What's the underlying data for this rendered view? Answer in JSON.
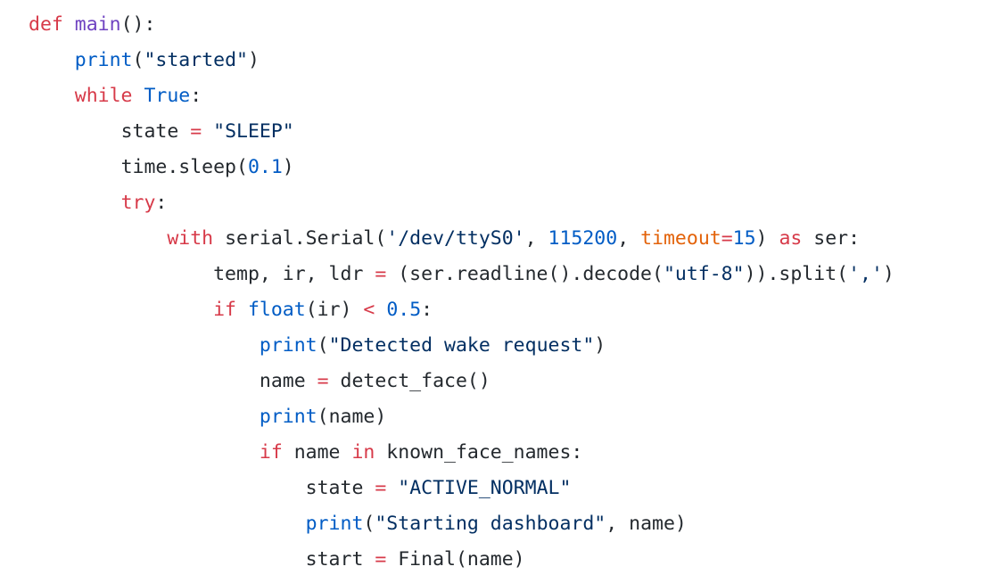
{
  "colors": {
    "keyword": "#d73a49",
    "function_def": "#6f42c1",
    "builtin": "#005cc5",
    "string": "#032f62",
    "number": "#005cc5",
    "operator": "#d73a49",
    "text": "#24292e",
    "param": "#e36209"
  },
  "code": {
    "language": "python",
    "lines": [
      {
        "indent": 0,
        "tokens": [
          {
            "t": "kw",
            "v": "def"
          },
          {
            "t": "var",
            "v": " "
          },
          {
            "t": "fn",
            "v": "main"
          },
          {
            "t": "var",
            "v": "():"
          }
        ]
      },
      {
        "indent": 1,
        "tokens": [
          {
            "t": "bi",
            "v": "print"
          },
          {
            "t": "var",
            "v": "("
          },
          {
            "t": "str",
            "v": "\"started\""
          },
          {
            "t": "var",
            "v": ")"
          }
        ]
      },
      {
        "indent": 1,
        "tokens": [
          {
            "t": "kw",
            "v": "while"
          },
          {
            "t": "var",
            "v": " "
          },
          {
            "t": "bi",
            "v": "True"
          },
          {
            "t": "var",
            "v": ":"
          }
        ]
      },
      {
        "indent": 2,
        "tokens": [
          {
            "t": "var",
            "v": "state "
          },
          {
            "t": "op",
            "v": "="
          },
          {
            "t": "var",
            "v": " "
          },
          {
            "t": "str",
            "v": "\"SLEEP\""
          }
        ]
      },
      {
        "indent": 2,
        "tokens": [
          {
            "t": "var",
            "v": "time.sleep("
          },
          {
            "t": "num",
            "v": "0.1"
          },
          {
            "t": "var",
            "v": ")"
          }
        ]
      },
      {
        "indent": 2,
        "tokens": [
          {
            "t": "kw",
            "v": "try"
          },
          {
            "t": "var",
            "v": ":"
          }
        ]
      },
      {
        "indent": 3,
        "tokens": [
          {
            "t": "kw",
            "v": "with"
          },
          {
            "t": "var",
            "v": " serial.Serial("
          },
          {
            "t": "str",
            "v": "'/dev/ttyS0'"
          },
          {
            "t": "var",
            "v": ", "
          },
          {
            "t": "num",
            "v": "115200"
          },
          {
            "t": "var",
            "v": ", "
          },
          {
            "t": "param",
            "v": "timeout"
          },
          {
            "t": "op",
            "v": "="
          },
          {
            "t": "num",
            "v": "15"
          },
          {
            "t": "var",
            "v": ") "
          },
          {
            "t": "kw",
            "v": "as"
          },
          {
            "t": "var",
            "v": " ser:"
          }
        ]
      },
      {
        "indent": 4,
        "tokens": [
          {
            "t": "var",
            "v": "temp, ir, ldr "
          },
          {
            "t": "op",
            "v": "="
          },
          {
            "t": "var",
            "v": " (ser.readline().decode("
          },
          {
            "t": "str",
            "v": "\"utf-8\""
          },
          {
            "t": "var",
            "v": ")).split("
          },
          {
            "t": "str",
            "v": "','"
          },
          {
            "t": "var",
            "v": ")"
          }
        ]
      },
      {
        "indent": 4,
        "tokens": [
          {
            "t": "kw",
            "v": "if"
          },
          {
            "t": "var",
            "v": " "
          },
          {
            "t": "bi",
            "v": "float"
          },
          {
            "t": "var",
            "v": "(ir) "
          },
          {
            "t": "op",
            "v": "<"
          },
          {
            "t": "var",
            "v": " "
          },
          {
            "t": "num",
            "v": "0.5"
          },
          {
            "t": "var",
            "v": ":"
          }
        ]
      },
      {
        "indent": 5,
        "tokens": [
          {
            "t": "bi",
            "v": "print"
          },
          {
            "t": "var",
            "v": "("
          },
          {
            "t": "str",
            "v": "\"Detected wake request\""
          },
          {
            "t": "var",
            "v": ")"
          }
        ]
      },
      {
        "indent": 5,
        "tokens": [
          {
            "t": "var",
            "v": "name "
          },
          {
            "t": "op",
            "v": "="
          },
          {
            "t": "var",
            "v": " detect_face()"
          }
        ]
      },
      {
        "indent": 5,
        "tokens": [
          {
            "t": "bi",
            "v": "print"
          },
          {
            "t": "var",
            "v": "(name)"
          }
        ]
      },
      {
        "indent": 5,
        "tokens": [
          {
            "t": "kw",
            "v": "if"
          },
          {
            "t": "var",
            "v": " name "
          },
          {
            "t": "kw",
            "v": "in"
          },
          {
            "t": "var",
            "v": " known_face_names:"
          }
        ]
      },
      {
        "indent": 6,
        "tokens": [
          {
            "t": "var",
            "v": "state "
          },
          {
            "t": "op",
            "v": "="
          },
          {
            "t": "var",
            "v": " "
          },
          {
            "t": "str",
            "v": "\"ACTIVE_NORMAL\""
          }
        ]
      },
      {
        "indent": 6,
        "tokens": [
          {
            "t": "bi",
            "v": "print"
          },
          {
            "t": "var",
            "v": "("
          },
          {
            "t": "str",
            "v": "\"Starting dashboard\""
          },
          {
            "t": "var",
            "v": ", name)"
          }
        ]
      },
      {
        "indent": 6,
        "tokens": [
          {
            "t": "var",
            "v": "start "
          },
          {
            "t": "op",
            "v": "="
          },
          {
            "t": "var",
            "v": " Final(name)"
          }
        ]
      }
    ]
  }
}
